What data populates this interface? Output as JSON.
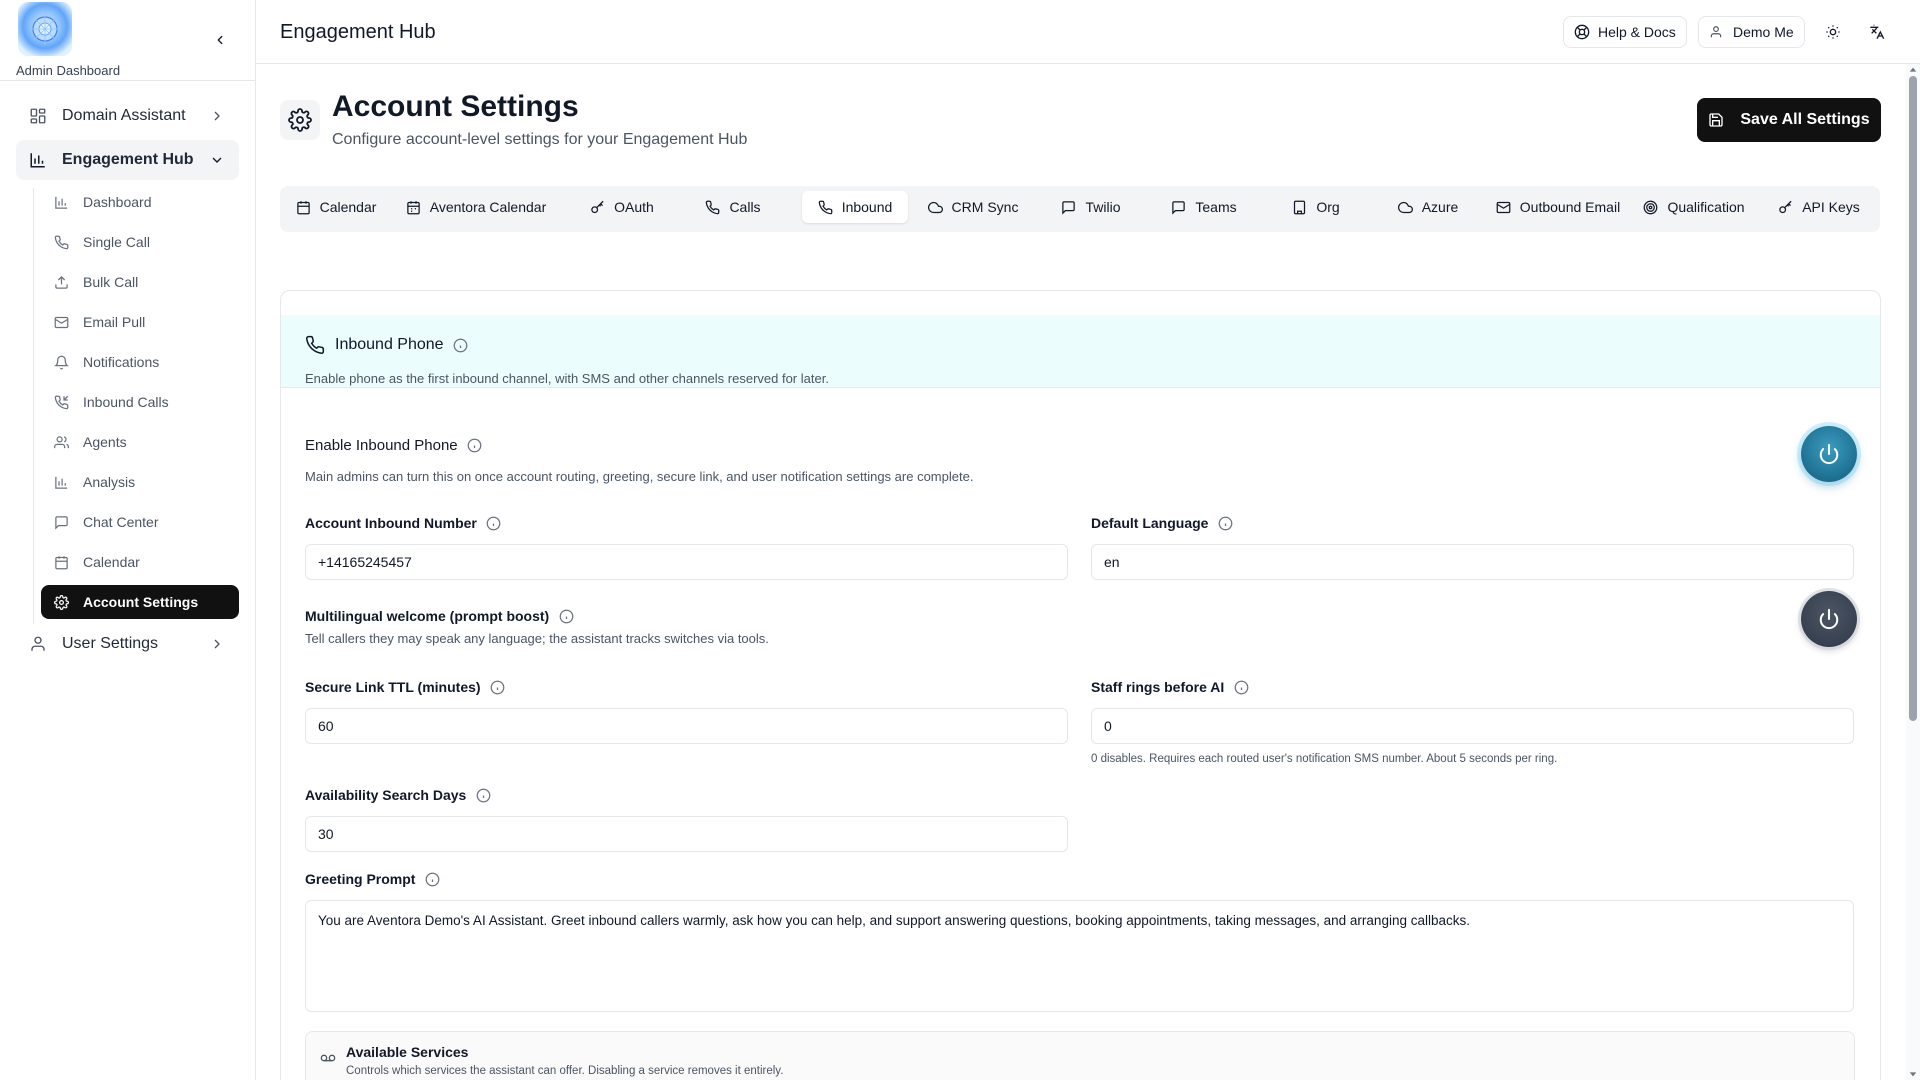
{
  "sidebar": {
    "app_label": "Admin Dashboard",
    "items": [
      {
        "label": "Domain Assistant",
        "icon": "grid-icon"
      },
      {
        "label": "Engagement Hub",
        "icon": "bar-chart-icon"
      },
      {
        "label": "User Settings",
        "icon": "user-icon"
      }
    ],
    "sub_items": [
      {
        "label": "Dashboard",
        "icon": "bar-chart-icon"
      },
      {
        "label": "Single Call",
        "icon": "phone-icon"
      },
      {
        "label": "Bulk Call",
        "icon": "upload-icon"
      },
      {
        "label": "Email Pull",
        "icon": "mail-icon"
      },
      {
        "label": "Notifications",
        "icon": "bell-icon"
      },
      {
        "label": "Inbound Calls",
        "icon": "phone-incoming-icon"
      },
      {
        "label": "Agents",
        "icon": "users-icon"
      },
      {
        "label": "Analysis",
        "icon": "bar-chart-icon"
      },
      {
        "label": "Chat Center",
        "icon": "message-icon"
      },
      {
        "label": "Calendar",
        "icon": "calendar-icon"
      },
      {
        "label": "Account Settings",
        "icon": "gear-icon"
      }
    ]
  },
  "header": {
    "title": "Engagement Hub",
    "help_label": "Help & Docs",
    "user_label": "Demo Me"
  },
  "page": {
    "title": "Account Settings",
    "subtitle": "Configure account-level settings for your Engagement Hub",
    "save_label": "Save All Settings"
  },
  "tabs": [
    {
      "label": "Calendar"
    },
    {
      "label": "Aventora Calendar"
    },
    {
      "label": "OAuth"
    },
    {
      "label": "Calls"
    },
    {
      "label": "Inbound"
    },
    {
      "label": "CRM Sync"
    },
    {
      "label": "Twilio"
    },
    {
      "label": "Teams"
    },
    {
      "label": "Org"
    },
    {
      "label": "Azure"
    },
    {
      "label": "Outbound Email"
    },
    {
      "label": "Qualification"
    },
    {
      "label": "API Keys"
    }
  ],
  "active_tab": "Inbound",
  "inbound": {
    "title": "Inbound Phone",
    "description": "Enable phone as the first inbound channel, with SMS and other channels reserved for later.",
    "enable_label": "Enable Inbound Phone",
    "enable_desc": "Main admins can turn this on once account routing, greeting, secure link, and user notification settings are complete.",
    "enable_on": true,
    "number_label": "Account Inbound Number",
    "number_value": "+14165245457",
    "language_label": "Default Language",
    "language_value": "en",
    "multilingual_label": "Multilingual welcome (prompt boost)",
    "multilingual_desc": "Tell callers they may speak any language; the assistant tracks switches via tools.",
    "multilingual_on": false,
    "ttl_label": "Secure Link TTL (minutes)",
    "ttl_value": "60",
    "rings_label": "Staff rings before AI",
    "rings_value": "0",
    "rings_hint": "0 disables. Requires each routed user's notification SMS number. About 5 seconds per ring.",
    "days_label": "Availability Search Days",
    "days_value": "30",
    "greeting_label": "Greeting Prompt",
    "greeting_value": "You are Aventora Demo's AI Assistant. Greet inbound callers warmly, ask how you can help, and support answering questions, booking appointments, taking messages, and arranging callbacks.",
    "services_title": "Available Services",
    "services_desc": "Controls which services the assistant can offer. Disabling a service removes it entirely."
  },
  "colors": {
    "accent_dark": "#111111",
    "card_header_bg": "#ecfdfd",
    "toggle_on": "#1d6f91",
    "toggle_off": "#374151"
  }
}
